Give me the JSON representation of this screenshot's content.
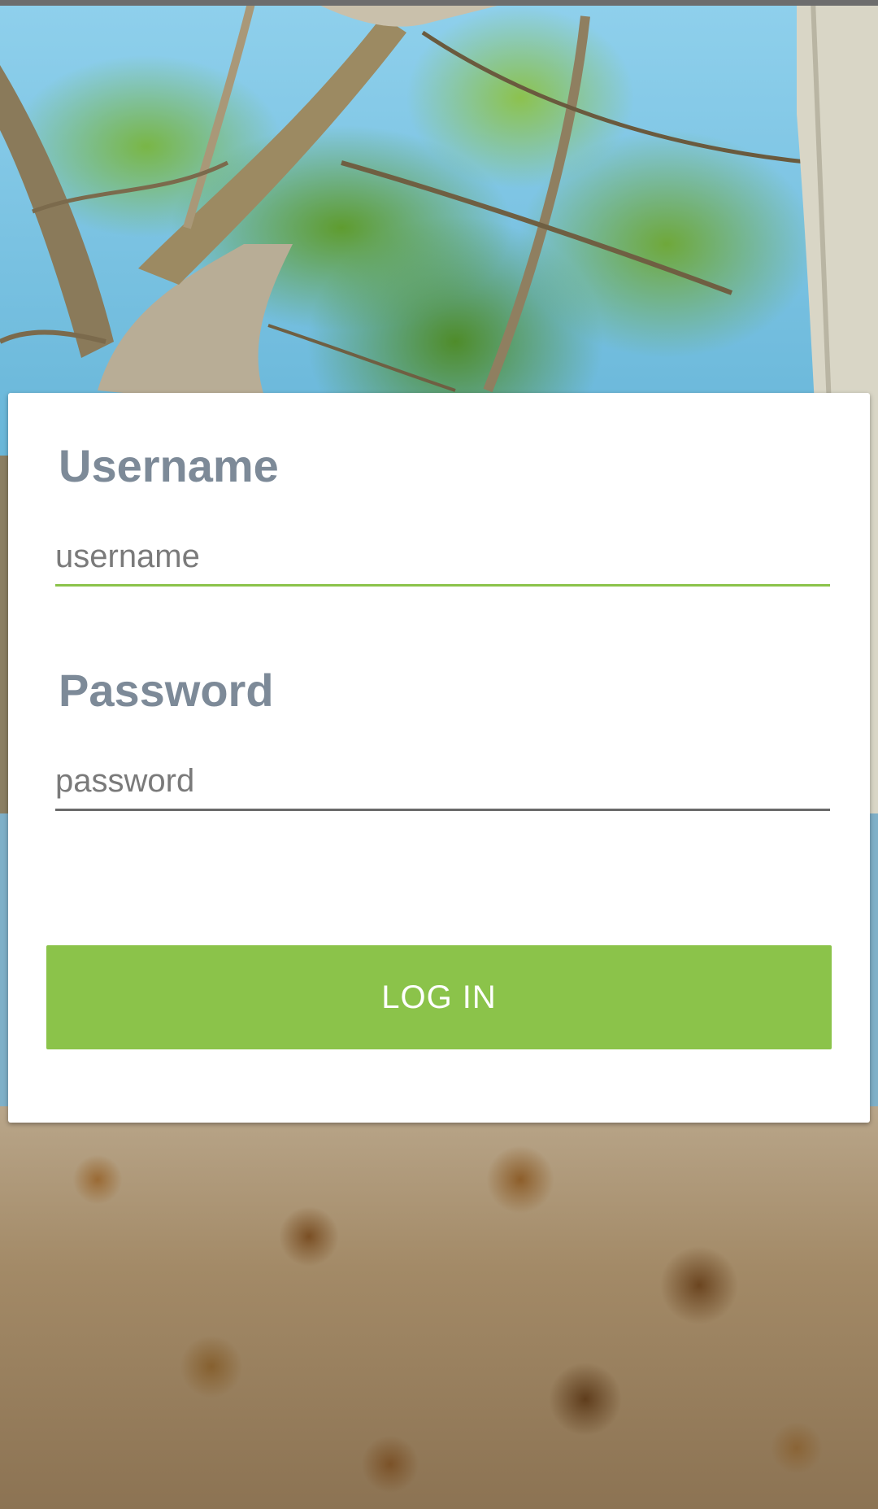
{
  "login_form": {
    "username_label": "Username",
    "username_placeholder": "username",
    "password_label": "Password",
    "password_placeholder": "password",
    "login_button_label": "LOG IN"
  },
  "colors": {
    "accent": "#8bc34a",
    "label_text": "#7d8a98",
    "card_background": "#ffffff"
  }
}
